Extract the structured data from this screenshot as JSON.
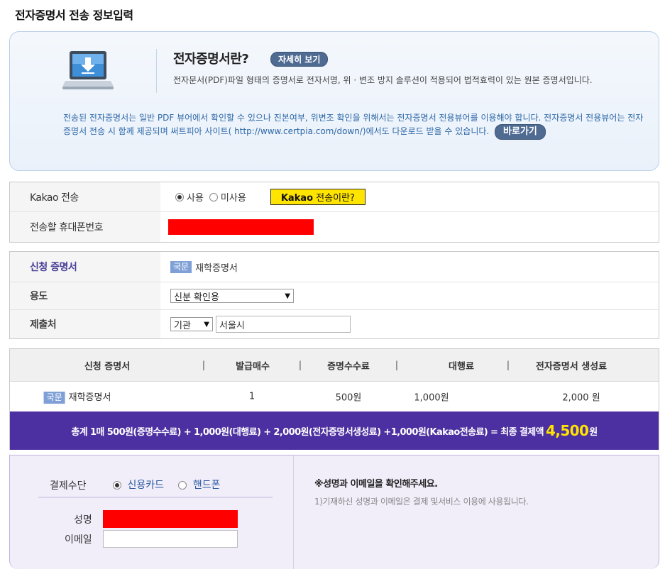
{
  "page_title": "전자증명서 전송 정보입력",
  "info": {
    "heading": "전자증명서란?",
    "detail_button": "자세히 보기",
    "description": "전자문서(PDF)파일 형태의 증명서로 전자서명, 위 · 변조 방지 솔루션이 적용되어 법적효력이 있는 원본 증명서입니다.",
    "notice": "전송된 전자증명서는 일반 PDF 뷰어에서 확인할 수 있으나 진본여부, 위변조 확인을 위해서는 전자증명서 전용뷰어를 이용해야 합니다. 전자증명서 전용뷰어는 전자증명서 전송 시 함께 제공되며 써트피아 사이트( http://www.certpia.com/down/)에서도 다운로드 받을 수 있습니다.",
    "go_button": "바로가기",
    "icon": "laptop-download-icon"
  },
  "kakao": {
    "label": "Kakao 전송",
    "option_use": "사용",
    "option_nouse": "미사용",
    "selected": "사용",
    "help_bold": "Kakao",
    "help_rest": " 전송이란?",
    "phone_label": "전송할 휴대폰번호"
  },
  "certificate": {
    "label": "신청 증명서",
    "tag": "국문",
    "name": "재학증명서",
    "purpose_label": "용도",
    "purpose_value": "신분 확인용",
    "submit_label": "제출처",
    "submit_type": "기관",
    "submit_value": "서울시"
  },
  "summary": {
    "headers": [
      "신청 증명서",
      "발급매수",
      "증명수수료",
      "대행료",
      "전자증명서 생성료"
    ],
    "row": {
      "tag": "국문",
      "name": "재학증명서",
      "copies": "1",
      "fee": "500원",
      "agency_fee": "1,000원",
      "generation_fee": "2,000 원"
    },
    "total_text": "총계 1매 500원(증명수수료) + 1,000원(대행료) + 2,000원(전자증명서생성료) +1,000원(Kakao전송료) = 최종 결제액",
    "total_amount": "4,500",
    "total_unit": "원"
  },
  "payment": {
    "method_label": "결제수단",
    "option_card": "신용카드",
    "option_phone": "핸드폰",
    "selected": "신용카드",
    "name_label": "성명",
    "email_label": "이메일",
    "notice_title": "※성명과 이메일을 확인해주세요.",
    "notice_text": "1)기재하신 성명과 이메일은 결제 및서비스 이용에 사용됩니다."
  },
  "colors": {
    "accent_purple": "#4c2fa0",
    "kakao_yellow": "#ffe400",
    "total_highlight": "#ffe400",
    "redacted": "#ff0000",
    "notice_blue": "#2c67a8"
  }
}
